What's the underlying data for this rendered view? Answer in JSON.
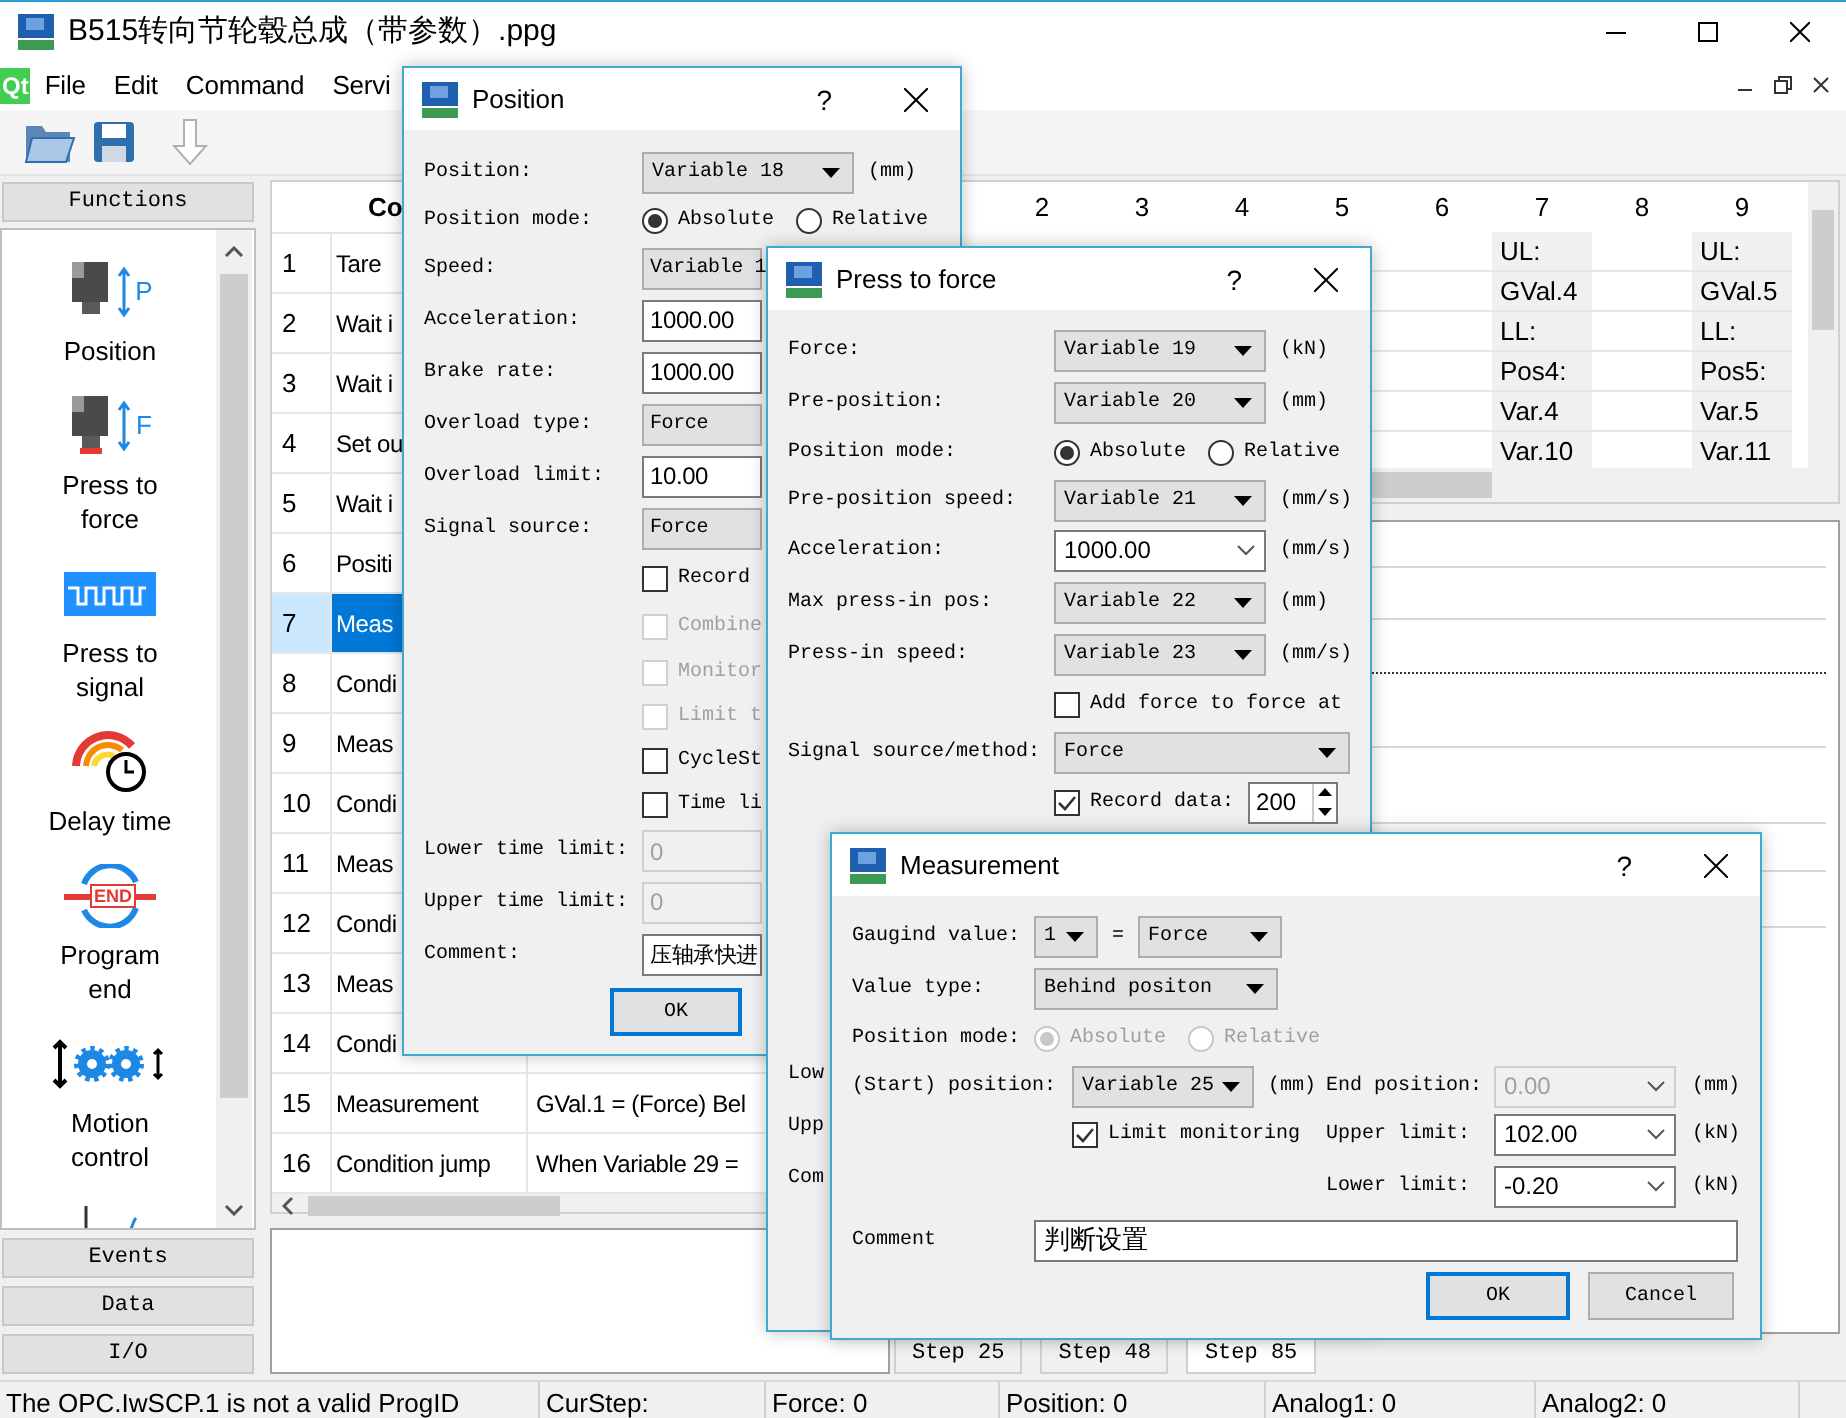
{
  "window": {
    "title": "B515转向节轮毂总成（带参数）.ppg"
  },
  "menu": {
    "logo": "Qt",
    "items": [
      "File",
      "Edit",
      "Command",
      "Servi"
    ]
  },
  "toolbar": [
    {
      "kind": "open",
      "disabled": false
    },
    {
      "kind": "save",
      "disabled": false
    },
    {
      "kind": "download",
      "disabled": true
    }
  ],
  "functions": {
    "header": "Functions",
    "items": [
      {
        "kind": "position",
        "label": "Position",
        "letter": "P"
      },
      {
        "kind": "force",
        "label": "Press to force",
        "letter": "F"
      },
      {
        "kind": "signal",
        "label": "Press to signal"
      },
      {
        "kind": "delay",
        "label": "Delay time"
      },
      {
        "kind": "end",
        "label": "Program end",
        "letter": "END"
      },
      {
        "kind": "motion",
        "label": "Motion control"
      },
      {
        "kind": "curve"
      }
    ],
    "sections": [
      "Events",
      "Data",
      "I/O"
    ]
  },
  "program_table": {
    "header": "Co",
    "rows": [
      {
        "number": "1",
        "command": "Tare",
        "selected": false
      },
      {
        "number": "2",
        "command": "Wait i",
        "selected": false
      },
      {
        "number": "3",
        "command": "Wait i",
        "selected": false
      },
      {
        "number": "4",
        "command": "Set ou",
        "selected": false
      },
      {
        "number": "5",
        "command": "Wait i",
        "selected": false
      },
      {
        "number": "6",
        "command": "Positi",
        "selected": false
      },
      {
        "number": "7",
        "command": "Meas",
        "selected": true
      },
      {
        "number": "8",
        "command": "Condi",
        "selected": false
      },
      {
        "number": "9",
        "command": "Meas",
        "selected": false
      },
      {
        "number": "10",
        "command": "Condi",
        "selected": false
      },
      {
        "number": "11",
        "command": "Meas",
        "selected": false
      },
      {
        "number": "12",
        "command": "Condi",
        "selected": false
      },
      {
        "number": "13",
        "command": "Meas",
        "selected": false
      },
      {
        "number": "14",
        "command": "Condi",
        "selected": false
      },
      {
        "number": "15",
        "command": "Measurement",
        "parameters": "GVal.1 = (Force) Bel",
        "selected": false
      },
      {
        "number": "16",
        "command": "Condition jump",
        "parameters": "When Variable 29 =",
        "selected": false
      }
    ]
  },
  "param_grid": {
    "columns": [
      "2",
      "3",
      "4",
      "5",
      "6",
      "7",
      "8",
      "9"
    ],
    "rows": [
      {
        "cells": [
          {},
          {},
          {},
          {},
          {},
          {
            "text": "UL:"
          },
          {},
          {
            "text": "UL:"
          }
        ]
      },
      {
        "cells": [
          {},
          {},
          {},
          {},
          {},
          {
            "text": "GVal.4"
          },
          {},
          {
            "text": "GVal.5"
          }
        ]
      },
      {
        "cells": [
          {},
          {},
          {},
          {},
          {},
          {
            "text": "LL:"
          },
          {},
          {
            "text": "LL:"
          }
        ]
      },
      {
        "cells": [
          {},
          {},
          {},
          {},
          {},
          {
            "text": "Pos4:"
          },
          {},
          {
            "text": "Pos5:"
          }
        ]
      },
      {
        "cells": [
          {},
          {},
          {},
          {},
          {},
          {
            "text": "Var.4"
          },
          {},
          {
            "text": "Var.5"
          }
        ]
      },
      {
        "cells": [
          {},
          {},
          {},
          {},
          {},
          {
            "text": "Var.10"
          },
          {},
          {
            "text": "Var.11"
          }
        ]
      }
    ]
  },
  "step_tabs": [
    {
      "label": "Step 25",
      "selected": false
    },
    {
      "label": "Step 48",
      "selected": false
    },
    {
      "label": "Step 85",
      "selected": true
    }
  ],
  "status_bar": [
    "The OPC.IwSCP.1 is not a valid ProgID",
    "CurStep:",
    "Force: 0",
    "Position: 0",
    "Analog1: 0",
    "Analog2: 0"
  ],
  "dialogs": [
    {
      "title": "Position",
      "help": "?",
      "rows": [
        {
          "label": "Position:",
          "controls": [
            {
              "kind": "combo",
              "value": "Variable 18",
              "disabled": false
            },
            {
              "kind": "unit",
              "text": "(mm)"
            }
          ]
        },
        {
          "label": "Position mode:",
          "controls": [
            {
              "kind": "radio",
              "text": "Absolute",
              "selected": true,
              "disabled": false
            },
            {
              "kind": "radio",
              "text": "Relative",
              "selected": false,
              "disabled": false
            }
          ]
        },
        {
          "label": "Speed:",
          "controls": [
            {
              "kind": "combo",
              "value": "Variable 1",
              "disabled": false
            }
          ]
        },
        {
          "label": "Acceleration:",
          "controls": [
            {
              "kind": "input",
              "value": "1000.00",
              "disabled": false
            }
          ]
        },
        {
          "label": "Brake rate:",
          "controls": [
            {
              "kind": "input",
              "value": "1000.00",
              "disabled": false
            }
          ]
        },
        {
          "label": "Overload type:",
          "controls": [
            {
              "kind": "combo",
              "value": "Force",
              "disabled": false
            }
          ]
        },
        {
          "label": "Overload limit:",
          "controls": [
            {
              "kind": "input",
              "value": "10.00",
              "disabled": false
            }
          ]
        },
        {
          "label": "Signal source:",
          "controls": [
            {
              "kind": "combo",
              "value": "Force",
              "disabled": false
            }
          ]
        },
        {
          "controls": [
            {
              "kind": "check",
              "text": "Record",
              "checked": false,
              "disabled": false
            }
          ]
        },
        {
          "controls": [
            {
              "kind": "check",
              "text": "Combine",
              "checked": false,
              "disabled": true
            }
          ]
        },
        {
          "controls": [
            {
              "kind": "check",
              "text": "Monitor",
              "checked": false,
              "disabled": true
            }
          ]
        },
        {
          "controls": [
            {
              "kind": "check",
              "text": "Limit t",
              "checked": false,
              "disabled": true
            }
          ]
        },
        {
          "controls": [
            {
              "kind": "check",
              "text": "CycleSt",
              "checked": false,
              "disabled": false
            }
          ]
        },
        {
          "controls": [
            {
              "kind": "check",
              "text": "Time li",
              "checked": false,
              "disabled": false
            }
          ]
        },
        {
          "label": "Lower time limit:",
          "controls": [
            {
              "kind": "input",
              "value": "0",
              "disabled": true
            }
          ]
        },
        {
          "label": "Upper time limit:",
          "controls": [
            {
              "kind": "input",
              "value": "0",
              "disabled": true
            }
          ]
        },
        {
          "label": "Comment:",
          "controls": [
            {
              "kind": "input",
              "value": "压轴承快进",
              "disabled": false
            }
          ]
        }
      ],
      "buttons": [
        {
          "label": "OK",
          "default": true
        }
      ]
    },
    {
      "title": "Press to force",
      "help": "?",
      "rows": [
        {
          "label": "Force:",
          "controls": [
            {
              "kind": "combo",
              "value": "Variable 19"
            },
            {
              "kind": "unit",
              "text": "(kN)"
            }
          ]
        },
        {
          "label": "Pre-position:",
          "controls": [
            {
              "kind": "combo",
              "value": "Variable 20"
            },
            {
              "kind": "unit",
              "text": "(mm)"
            }
          ]
        },
        {
          "label": "Position mode:",
          "controls": [
            {
              "kind": "radio",
              "text": "Absolute",
              "selected": true
            },
            {
              "kind": "radio",
              "text": "Relative",
              "selected": false
            }
          ]
        },
        {
          "label": "Pre-position speed:",
          "controls": [
            {
              "kind": "combo",
              "value": "Variable 21"
            },
            {
              "kind": "unit",
              "text": "(mm/s)"
            }
          ]
        },
        {
          "label": "Acceleration:",
          "controls": [
            {
              "kind": "edit",
              "value": "1000.00"
            },
            {
              "kind": "unit",
              "text": "(mm/s)"
            }
          ]
        },
        {
          "label": "Max press-in pos:",
          "controls": [
            {
              "kind": "combo",
              "value": "Variable 22"
            },
            {
              "kind": "unit",
              "text": "(mm)"
            }
          ]
        },
        {
          "label": "Press-in speed:",
          "controls": [
            {
              "kind": "combo",
              "value": "Variable 23"
            },
            {
              "kind": "unit",
              "text": "(mm/s)"
            }
          ]
        },
        {
          "controls": [
            {
              "kind": "check",
              "text": "Add force to force at",
              "checked": false
            }
          ]
        },
        {
          "label": "Signal source/method:",
          "controls": [
            {
              "kind": "combo",
              "value": "Force"
            }
          ]
        },
        {
          "controls": [
            {
              "kind": "check",
              "text": "Record data:",
              "checked": true
            },
            {
              "kind": "spin",
              "value": "200"
            }
          ]
        },
        {
          "label": "Low"
        },
        {
          "label": "Upp"
        },
        {
          "label": "Com"
        }
      ]
    },
    {
      "title": "Measurement",
      "help": "?",
      "rows": [
        {
          "label": "Gaugind value:",
          "controls": [
            {
              "kind": "combo",
              "value": "1",
              "disabled": false
            },
            {
              "kind": "unit",
              "text": "="
            },
            {
              "kind": "combo",
              "value": "Force",
              "disabled": false
            }
          ]
        },
        {
          "label": "Value type:",
          "controls": [
            {
              "kind": "combo",
              "value": "Behind positon",
              "disabled": false
            }
          ]
        },
        {
          "label": "Position mode:",
          "controls": [
            {
              "kind": "radio",
              "text": "Absolute",
              "selected": true,
              "disabled": true
            },
            {
              "kind": "radio",
              "text": "Relative",
              "selected": false,
              "disabled": true
            }
          ]
        },
        {
          "label": "(Start) position:",
          "controls": [
            {
              "kind": "combo",
              "value": "Variable 25",
              "disabled": false
            },
            {
              "kind": "unit",
              "text": "(mm)"
            },
            {
              "kind": "text",
              "text": "End position:"
            },
            {
              "kind": "edit",
              "value": "0.00",
              "disabled": true
            },
            {
              "kind": "unit",
              "text": "(mm)"
            }
          ]
        },
        {
          "controls": [
            {
              "kind": "check",
              "text": "Limit monitoring",
              "checked": true,
              "disabled": false
            },
            {
              "kind": "text",
              "text": "Upper limit:"
            },
            {
              "kind": "edit",
              "value": "102.00",
              "disabled": false
            },
            {
              "kind": "unit",
              "text": "(kN)"
            }
          ]
        },
        {
          "controls": [
            {
              "kind": "text",
              "text": "Lower limit:"
            },
            {
              "kind": "edit",
              "value": "-0.20",
              "disabled": false
            },
            {
              "kind": "unit",
              "text": "(kN)"
            }
          ]
        },
        {
          "label": "Comment",
          "controls": [
            {
              "kind": "input",
              "value": "判断设置",
              "disabled": false
            }
          ]
        }
      ],
      "buttons": [
        {
          "label": "OK",
          "default": true
        },
        {
          "label": "Cancel",
          "default": false
        }
      ]
    }
  ]
}
